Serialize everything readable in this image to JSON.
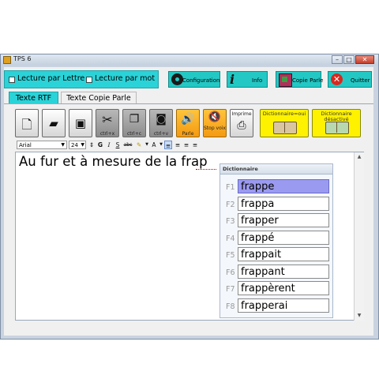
{
  "window": {
    "title": "TPS 6",
    "icon": "app-icon"
  },
  "modes": {
    "lecture_lettre": "Lecture par Lettre",
    "lecture_mot": "Lecture par mot"
  },
  "top_buttons": {
    "configuration": "Configuration",
    "info": "Info",
    "copie_parle": "Copie Parle",
    "quitter": "Quitter"
  },
  "tabs": {
    "rtf": "Texte RTF",
    "copie_parle": "Texte Copie Parle",
    "active": "rtf"
  },
  "toolbar": {
    "cut": "ctrl+x",
    "copy": "ctrl+c",
    "paste": "ctrl+v",
    "speak": "Parle",
    "stop_voice": "Stop voix",
    "print": "Imprime",
    "dict_on": "Dictionnaire=oui",
    "dict_off": "Dictionnaire désactivé"
  },
  "format": {
    "font": "Arial",
    "size": "24",
    "bold": "G",
    "italic": "I",
    "strike": "S",
    "abc": "abc",
    "color_a": "A"
  },
  "editor": {
    "text": "Au fur et à mesure de la frap"
  },
  "dictionary": {
    "title": "Dictionnaire",
    "items": [
      {
        "key": "F1",
        "word": "frappe",
        "selected": true
      },
      {
        "key": "F2",
        "word": "frappa"
      },
      {
        "key": "F3",
        "word": "frapper"
      },
      {
        "key": "F4",
        "word": "frappé"
      },
      {
        "key": "F5",
        "word": "frappait"
      },
      {
        "key": "F6",
        "word": "frappant"
      },
      {
        "key": "F7",
        "word": "frappèrent"
      },
      {
        "key": "F8",
        "word": "frapperai"
      }
    ]
  },
  "colors": {
    "accent": "#2ad3d8",
    "orange": "#f39a12",
    "yellow": "#fff200",
    "selection": "#9a9af0"
  }
}
